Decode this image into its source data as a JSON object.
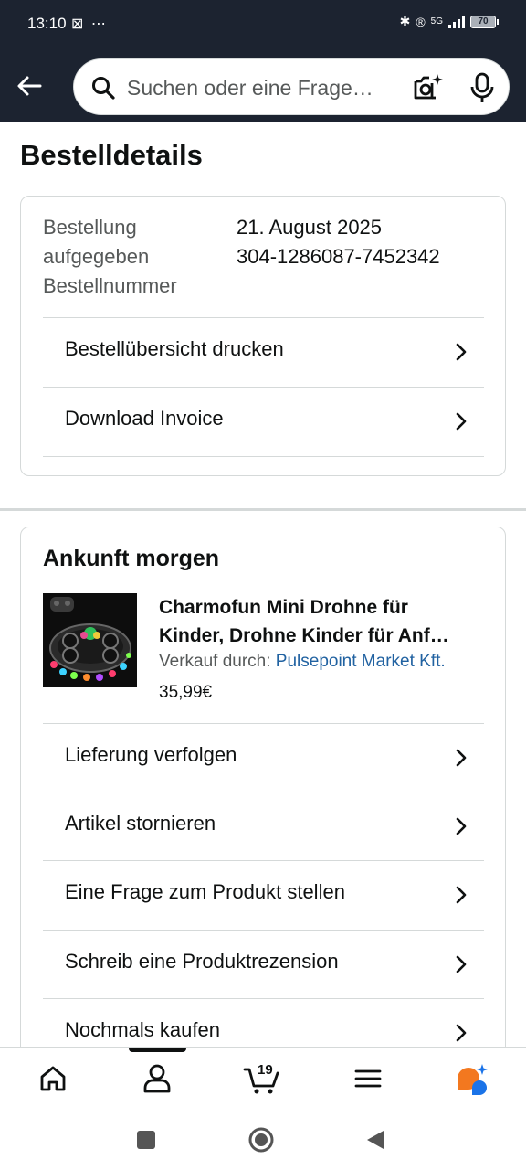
{
  "status_bar": {
    "time": "13:10",
    "left_icons": "⊠ ⋯",
    "network": "5G",
    "battery": "70"
  },
  "search": {
    "placeholder": "Suchen oder eine Frage…"
  },
  "page": {
    "title": "Bestelldetails"
  },
  "order_info": {
    "labels": [
      "Bestellung",
      "aufgegeben",
      "Bestellnummer"
    ],
    "date": "21. August 2025",
    "order_number": "304-1286087-7452342"
  },
  "order_actions": [
    {
      "label": "Bestellübersicht drucken"
    },
    {
      "label": "Download Invoice"
    }
  ],
  "shipment": {
    "heading": "Ankunft morgen",
    "product": {
      "title_line1": "Charmofun Mini Drohne für",
      "title_line2": "Kinder, Drohne Kinder für Anf…",
      "seller_prefix": "Verkauf durch: ",
      "seller_name": "Pulsepoint Market Kft.",
      "price": "35,99€"
    },
    "actions": [
      {
        "label": "Lieferung verfolgen"
      },
      {
        "label": "Artikel stornieren"
      },
      {
        "label": "Eine Frage zum Produkt stellen"
      },
      {
        "label": "Schreib eine Produktrezension"
      },
      {
        "label": "Nochmals kaufen"
      }
    ]
  },
  "bottom_nav": {
    "cart_count": "19",
    "items": [
      "home-icon",
      "account-icon",
      "cart-icon",
      "menu-icon",
      "rufus-icon"
    ]
  },
  "colors": {
    "header_bg": "#1c2330",
    "link": "#2162a1",
    "divider": "#d5d9d9",
    "rufus_orange": "#f3781f",
    "rufus_blue": "#1a73e8"
  }
}
